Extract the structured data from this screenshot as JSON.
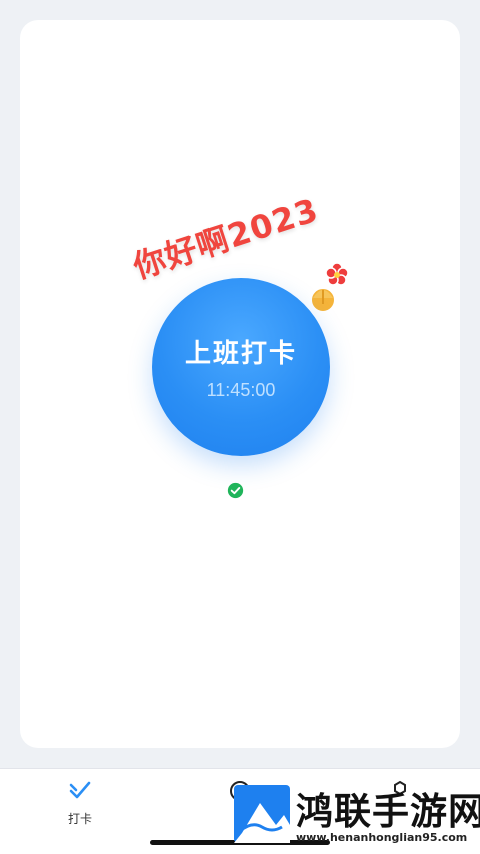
{
  "greeting": {
    "text": "你好啊2023"
  },
  "clock_button": {
    "title": "上班打卡",
    "time": "11:45:00"
  },
  "status": {
    "icon": "check-circle-icon",
    "color": "#1fb45a"
  },
  "tabbar": {
    "items": [
      {
        "label": "打卡",
        "icon": "check-icon",
        "active": true
      },
      {
        "label": "",
        "icon": "stats-icon",
        "active": false
      },
      {
        "label": "",
        "icon": "settings-icon",
        "active": false
      }
    ]
  },
  "watermark": {
    "title": "鸿联手游网",
    "url": "www.henanhonglian95.com"
  },
  "colors": {
    "accent": "#2b8ff5",
    "greeting": "#f0453e"
  }
}
